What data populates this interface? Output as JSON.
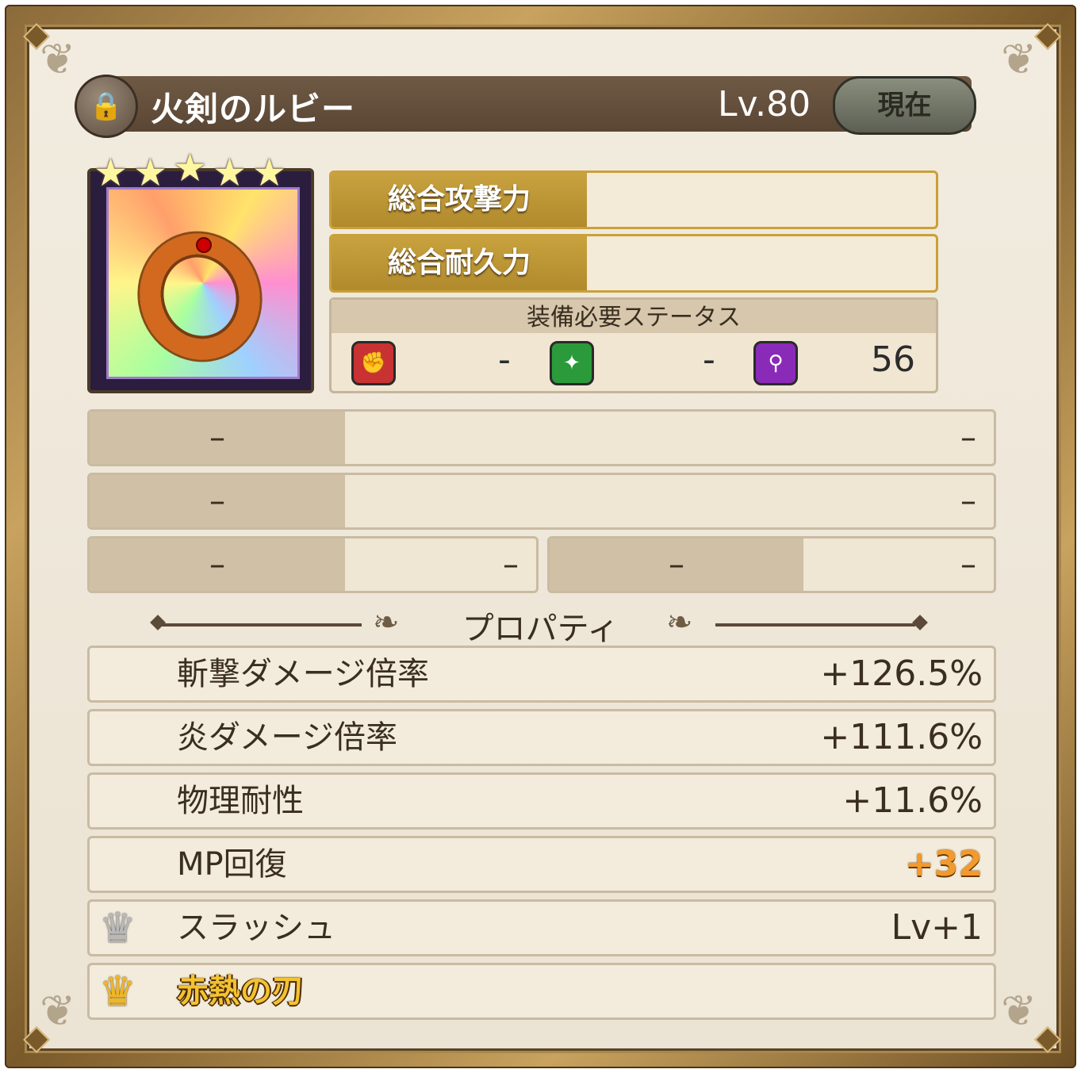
{
  "item": {
    "name": "火剣のルビー",
    "level": "Lv.80",
    "status_button": "現在",
    "stars": 5,
    "icon": "ring-icon"
  },
  "power": {
    "attack_label": "総合攻撃力",
    "attack_value": "",
    "durability_label": "総合耐久力",
    "durability_value": ""
  },
  "requirements": {
    "header": "装備必要ステータス",
    "items": [
      {
        "icon": "fist-icon",
        "color": "#c83232",
        "value": "-"
      },
      {
        "icon": "sparkle-icon",
        "color": "#2a9a3a",
        "value": "-"
      },
      {
        "icon": "wand-icon",
        "color": "#8a2ab8",
        "value": "56"
      }
    ]
  },
  "slots": {
    "row1": {
      "left": "–",
      "right": "–"
    },
    "row2": {
      "left": "–",
      "right": "–"
    },
    "row3a": {
      "left": "–",
      "right": "–"
    },
    "row3b": {
      "left": "–",
      "right": "–"
    }
  },
  "properties": {
    "title": "プロパティ",
    "rows": [
      {
        "label": "斬撃ダメージ倍率",
        "value": "+126.5%"
      },
      {
        "label": "炎ダメージ倍率",
        "value": "+111.6%"
      },
      {
        "label": "物理耐性",
        "value": "+11.6%"
      },
      {
        "label": "MP回復",
        "value": "+32",
        "highlight_color": "#f29a2e"
      },
      {
        "label": "スラッシュ",
        "value": "Lv+1",
        "icon": "silver-crown-icon"
      },
      {
        "label": "赤熱の刃",
        "value": "",
        "icon": "gold-crown-icon"
      }
    ]
  }
}
